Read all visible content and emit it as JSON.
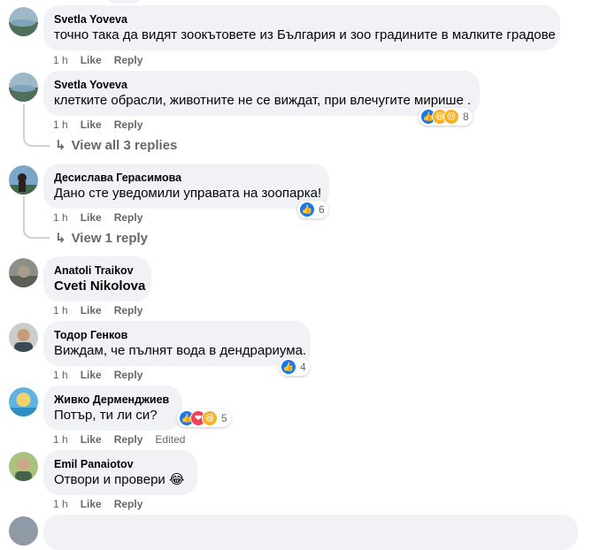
{
  "comments": [
    {
      "author": "Svetla Yoveva",
      "text": "точно така да видят зоокътовете из България и зоо градините в малките градове",
      "time": "1 h",
      "like": "Like",
      "reply": "Reply"
    },
    {
      "author": "Svetla Yoveva",
      "text": "клетките обрасли, животните не се виждат, при влечугите мирише .",
      "time": "1 h",
      "like": "Like",
      "reply": "Reply",
      "reactions": [
        "like-icon",
        "haha-icon",
        "sad-icon"
      ],
      "reaction_count": "8",
      "replies_link": "View all 3 replies"
    },
    {
      "author": "Десислава Герасимова",
      "text": "Дано сте уведомили управата на зоопарка!",
      "time": "1 h",
      "like": "Like",
      "reply": "Reply",
      "reactions": [
        "like-icon"
      ],
      "reaction_count": "6",
      "replies_link": "View 1 reply"
    },
    {
      "author": "Anatoli Traikov",
      "text": "Cveti Nikolova",
      "time": "1 h",
      "like": "Like",
      "reply": "Reply"
    },
    {
      "author": "Тодор Генков",
      "text": "Виждам, че пълнят вода в дендрариума.",
      "time": "1 h",
      "like": "Like",
      "reply": "Reply",
      "reactions": [
        "like-icon"
      ],
      "reaction_count": "4"
    },
    {
      "author": "Живко Дерменджиев",
      "text": "Потър, ти ли си?",
      "time": "1 h",
      "like": "Like",
      "reply": "Reply",
      "edited": "Edited",
      "reactions": [
        "like-icon",
        "love-icon",
        "haha-icon"
      ],
      "reaction_count": "5"
    },
    {
      "author": "Emil Panaiotov",
      "text": "Отвори и провери",
      "emoji": "😂",
      "time": "1 h",
      "like": "Like",
      "reply": "Reply"
    }
  ],
  "colors": {
    "bubble": "#f0f2f5",
    "meta": "#65676b",
    "like": "#1877f2",
    "love": "#f33e58",
    "haha": "#f7b125"
  }
}
